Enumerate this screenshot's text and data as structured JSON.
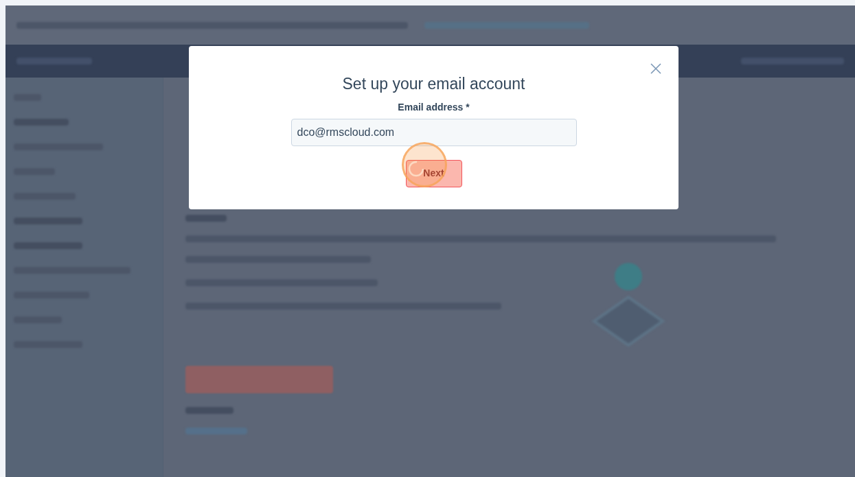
{
  "modal": {
    "title": "Set up your email account",
    "field": {
      "label": "Email address *",
      "value": "dco@rmscloud.com"
    },
    "next_button": {
      "label": "Next",
      "loading": true
    }
  }
}
